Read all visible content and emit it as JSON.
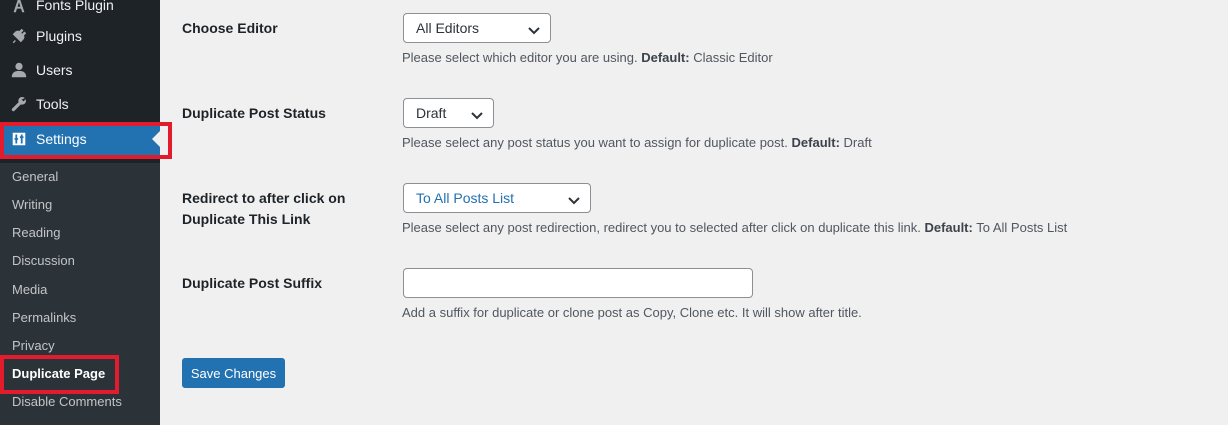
{
  "sidebar": {
    "items": [
      {
        "label": "Fonts Plugin",
        "icon": "fonts-icon"
      },
      {
        "label": "Plugins",
        "icon": "plugin-icon"
      },
      {
        "label": "Users",
        "icon": "user-icon"
      },
      {
        "label": "Tools",
        "icon": "wrench-icon"
      },
      {
        "label": "Settings",
        "icon": "settings-icon"
      }
    ],
    "submenu": [
      {
        "label": "General"
      },
      {
        "label": "Writing"
      },
      {
        "label": "Reading"
      },
      {
        "label": "Discussion"
      },
      {
        "label": "Media"
      },
      {
        "label": "Permalinks"
      },
      {
        "label": "Privacy"
      },
      {
        "label": "Duplicate Page"
      },
      {
        "label": "Disable Comments"
      }
    ]
  },
  "form": {
    "editor": {
      "label": "Choose Editor",
      "value": "All Editors",
      "desc": "Please select which editor you are using.",
      "default_label": "Default:",
      "default_value": "Classic Editor"
    },
    "status": {
      "label": "Duplicate Post Status",
      "value": "Draft",
      "desc": "Please select any post status you want to assign for duplicate post.",
      "default_label": "Default:",
      "default_value": "Draft"
    },
    "redirect": {
      "label_line1": "Redirect to after click on",
      "label_line2": "Duplicate This Link",
      "value": "To All Posts List",
      "desc": "Please select any post redirection, redirect you to selected after click on duplicate this link.",
      "default_label": "Default:",
      "default_value": "To All Posts List"
    },
    "suffix": {
      "label": "Duplicate Post Suffix",
      "value": "",
      "desc": "Add a suffix for duplicate or clone post as Copy, Clone etc. It will show after title."
    },
    "save_label": "Save Changes"
  },
  "colors": {
    "sidebar_bg": "#1d2327",
    "submenu_bg": "#2c3338",
    "accent": "#2271b1",
    "highlight": "#e21c2c"
  }
}
